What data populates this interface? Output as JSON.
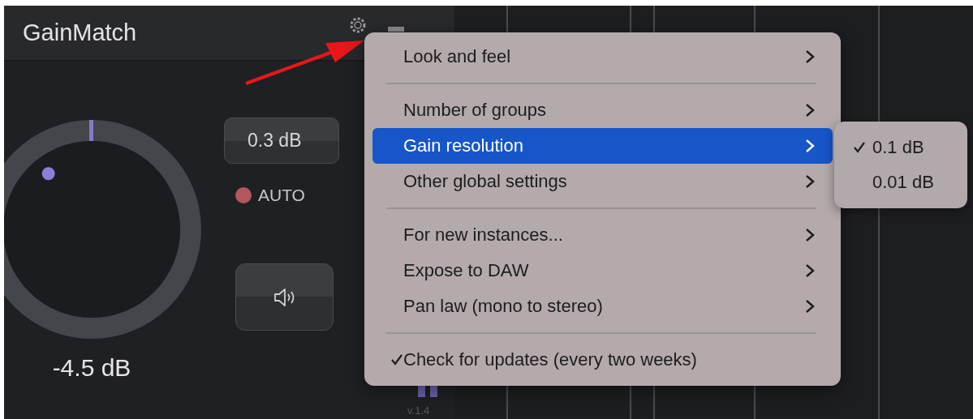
{
  "plugin": {
    "title": "GainMatch",
    "knob": {
      "reading": "-4.5 dB"
    },
    "offset_button": "0.3 dB",
    "auto": {
      "label": "AUTO",
      "on": true
    },
    "version": "v.1.4"
  },
  "menu": {
    "groups": [
      [
        {
          "label": "Look and feel",
          "submenu": true,
          "selected": false,
          "checked": false
        }
      ],
      [
        {
          "label": "Number of groups",
          "submenu": true,
          "selected": false,
          "checked": false
        },
        {
          "label": "Gain resolution",
          "submenu": true,
          "selected": true,
          "checked": false
        },
        {
          "label": "Other global settings",
          "submenu": true,
          "selected": false,
          "checked": false
        }
      ],
      [
        {
          "label": "For new instances...",
          "submenu": true,
          "selected": false,
          "checked": false
        },
        {
          "label": "Expose to DAW",
          "submenu": true,
          "selected": false,
          "checked": false
        },
        {
          "label": "Pan law (mono to stereo)",
          "submenu": true,
          "selected": false,
          "checked": false
        }
      ],
      [
        {
          "label": "Check for updates (every two weeks)",
          "submenu": false,
          "selected": false,
          "checked": true
        }
      ]
    ]
  },
  "submenu": {
    "items": [
      {
        "label": "0.1 dB",
        "checked": true
      },
      {
        "label": "0.01 dB",
        "checked": false
      }
    ]
  }
}
